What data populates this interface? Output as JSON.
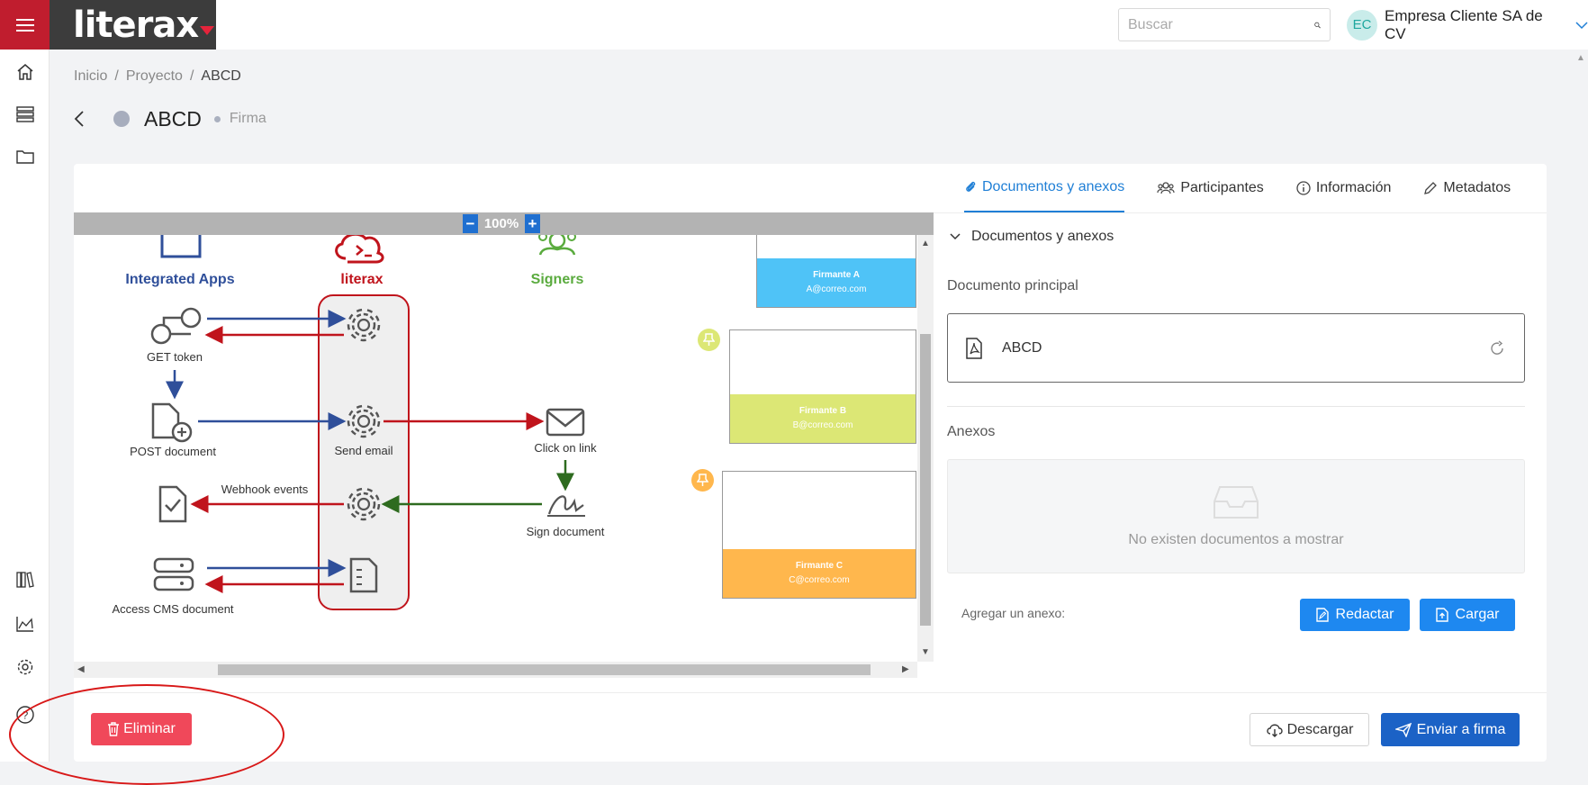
{
  "header": {
    "logo_text": "literax",
    "search": {
      "placeholder": "Buscar"
    },
    "user": {
      "initials": "EC",
      "name": "Empresa Cliente SA de CV"
    }
  },
  "sidebar": {
    "items": [
      {
        "icon": "home-icon"
      },
      {
        "icon": "list-icon"
      },
      {
        "icon": "folder-icon"
      },
      {
        "icon": "library-icon"
      },
      {
        "icon": "chart-icon"
      },
      {
        "icon": "gear-icon"
      },
      {
        "icon": "help-icon"
      }
    ]
  },
  "breadcrumb": {
    "items": [
      "Inicio",
      "Proyecto",
      "ABCD"
    ],
    "separator": "/"
  },
  "page": {
    "title": "ABCD",
    "stage": "Firma"
  },
  "viewer": {
    "zoom": "100%",
    "diagram": {
      "col_apps": "Integrated Apps",
      "col_literax": "literax",
      "col_signers": "Signers",
      "get_token": "GET token",
      "post_document": "POST document",
      "send_email": "Send email",
      "click_link": "Click on link",
      "webhook_events": "Webhook events",
      "sign_document": "Sign document",
      "access_cms": "Access CMS document"
    },
    "signers": [
      {
        "name": "Firmante A",
        "email": "A@correo.com",
        "color": "#4fc3f7"
      },
      {
        "name": "Firmante B",
        "email": "B@correo.com",
        "color": "#dce775"
      },
      {
        "name": "Firmante C",
        "email": "C@correo.com",
        "color": "#ffb74d"
      }
    ]
  },
  "panel": {
    "tabs": [
      {
        "label": "Documentos y anexos",
        "active": true
      },
      {
        "label": "Participantes"
      },
      {
        "label": "Información"
      },
      {
        "label": "Metadatos"
      }
    ],
    "accordion_title": "Documentos y anexos",
    "main_doc_label": "Documento principal",
    "main_doc_name": "ABCD",
    "annexes_label": "Anexos",
    "annexes_empty": "No existen documentos a mostrar",
    "add_annex_label": "Agregar un anexo:",
    "btn_draft": "Redactar",
    "btn_upload": "Cargar"
  },
  "footer": {
    "btn_delete": "Eliminar",
    "btn_download": "Descargar",
    "btn_send": "Enviar a firma"
  },
  "colors": {
    "brand_red": "#c01d2e",
    "primary_blue": "#1e88f0",
    "send_blue": "#1b62c6",
    "delete_red": "#f0485a"
  }
}
